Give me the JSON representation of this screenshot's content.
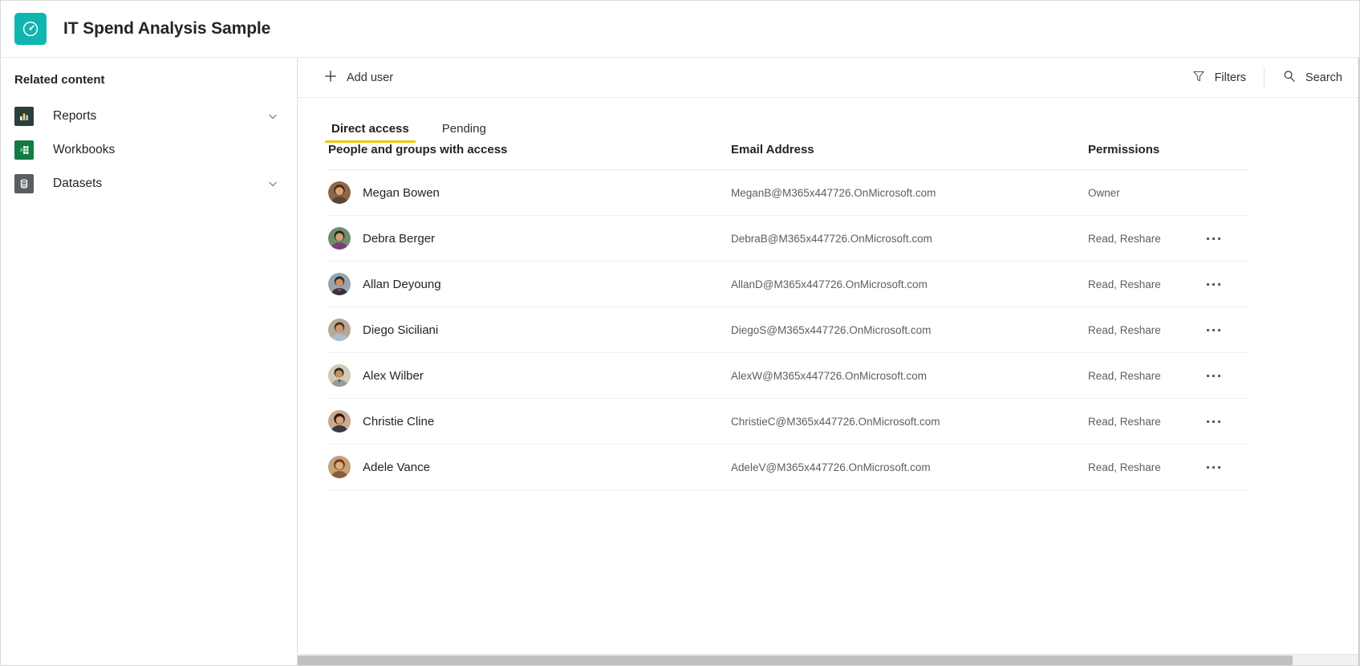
{
  "header": {
    "title": "IT Spend Analysis Sample",
    "logo_icon": "gauge-icon",
    "logo_color": "#0fb5ae"
  },
  "sidebar": {
    "title": "Related content",
    "items": [
      {
        "label": "Reports",
        "icon": "bar-chart-icon",
        "icon_color": "#2c3e3a",
        "expandable": true
      },
      {
        "label": "Workbooks",
        "icon": "excel-workbook-icon",
        "icon_color": "#107c41",
        "expandable": false
      },
      {
        "label": "Datasets",
        "icon": "database-icon",
        "icon_color": "#5a5d62",
        "expandable": true
      }
    ]
  },
  "commandbar": {
    "add_user_label": "Add user",
    "add_user_icon": "plus-icon",
    "filters_label": "Filters",
    "filters_icon": "funnel-icon",
    "search_label": "Search",
    "search_icon": "search-icon"
  },
  "tabs": [
    {
      "label": "Direct access",
      "active": true
    },
    {
      "label": "Pending",
      "active": false
    }
  ],
  "table": {
    "columns": {
      "people": "People and groups with access",
      "email": "Email Address",
      "permissions": "Permissions"
    },
    "rows": [
      {
        "name": "Megan Bowen",
        "email": "MeganB@M365x447726.OnMicrosoft.com",
        "permissions": "Owner",
        "has_menu": false,
        "avatar_bg": "#8d6748",
        "avatar_hair": "#3b2a20"
      },
      {
        "name": "Debra Berger",
        "email": "DebraB@M365x447726.OnMicrosoft.com",
        "permissions": "Read, Reshare",
        "has_menu": true,
        "avatar_bg": "#6f8d6b",
        "avatar_hair": "#7d3f7a"
      },
      {
        "name": "Allan Deyoung",
        "email": "AllanD@M365x447726.OnMicrosoft.com",
        "permissions": "Read, Reshare",
        "has_menu": true,
        "avatar_bg": "#9aa4b0",
        "avatar_hair": "#2b2b2f"
      },
      {
        "name": "Diego Siciliani",
        "email": "DiegoS@M365x447726.OnMicrosoft.com",
        "permissions": "Read, Reshare",
        "has_menu": true,
        "avatar_bg": "#b6a894",
        "avatar_hair": "#3a2d24"
      },
      {
        "name": "Alex Wilber",
        "email": "AlexW@M365x447726.OnMicrosoft.com",
        "permissions": "Read, Reshare",
        "has_menu": true,
        "avatar_bg": "#cfcbb7",
        "avatar_hair": "#2f2a25"
      },
      {
        "name": "Christie Cline",
        "email": "ChristieC@M365x447726.OnMicrosoft.com",
        "permissions": "Read, Reshare",
        "has_menu": true,
        "avatar_bg": "#c9a98f",
        "avatar_hair": "#221c18"
      },
      {
        "name": "Adele Vance",
        "email": "AdeleV@M365x447726.OnMicrosoft.com",
        "permissions": "Read, Reshare",
        "has_menu": true,
        "avatar_bg": "#c8a07a",
        "avatar_hair": "#6b3f24"
      }
    ]
  },
  "colors": {
    "accent_tab_underline": "#f2c811",
    "brand_teal": "#0fb5ae"
  }
}
